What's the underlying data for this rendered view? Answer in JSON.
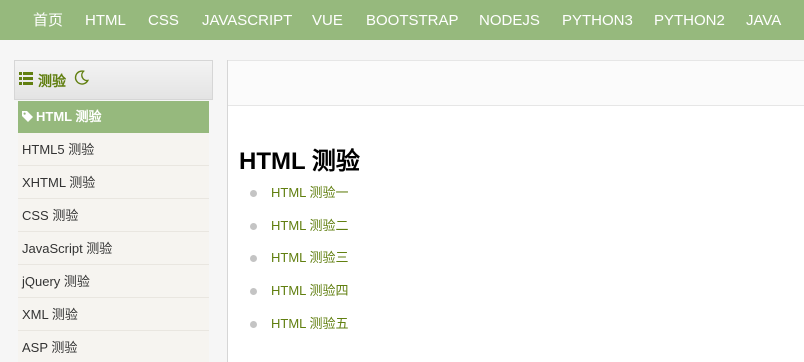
{
  "topnav": {
    "items": [
      "首页",
      "HTML",
      "CSS",
      "JAVASCRIPT",
      "VUE",
      "BOOTSTRAP",
      "NODEJS",
      "PYTHON3",
      "PYTHON2",
      "JAVA"
    ]
  },
  "sidebar": {
    "title": "测验",
    "icons": {
      "list": "list-icon",
      "moon": "moon-icon",
      "tag": "tag-icon"
    },
    "items": [
      {
        "label": "HTML 测验",
        "active": true
      },
      {
        "label": "HTML5 测验"
      },
      {
        "label": "XHTML 测验"
      },
      {
        "label": "CSS 测验"
      },
      {
        "label": "JavaScript 测验"
      },
      {
        "label": "jQuery 测验"
      },
      {
        "label": "XML 测验"
      },
      {
        "label": "ASP 测验"
      }
    ]
  },
  "content": {
    "heading": "HTML 测验",
    "links": [
      "HTML 测验一",
      "HTML 测验二",
      "HTML 测验三",
      "HTML 测验四",
      "HTML 测验五"
    ]
  },
  "colors": {
    "accent": "#96b97d",
    "link": "#617f10"
  }
}
